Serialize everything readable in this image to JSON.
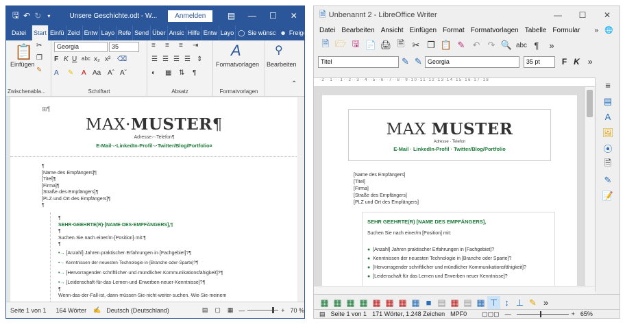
{
  "word": {
    "doc_title": "Unsere Geschichte.odt - W...",
    "signin": "Anmelden",
    "tabs": [
      "Datei",
      "Start",
      "Einfü",
      "Zeicl",
      "Entw",
      "Layo",
      "Refe",
      "Send",
      "Über",
      "Ansic",
      "Hilfe",
      "Entw",
      "Layo"
    ],
    "tell_me": "Sie wünsc",
    "share": "Freigeb",
    "paste": "Einfügen",
    "font_name": "Georgia",
    "font_size": "35",
    "styles": "Formatvorlagen",
    "edit": "Bearbeiten",
    "groups": [
      "Zwischenabla...",
      "Schriftart",
      "Absatz",
      "Formatvorlagen"
    ],
    "doc": {
      "name_light": "MAX·",
      "name_bold": "MUSTER",
      "contact": "Adresse·-·Telefon¶",
      "links": "E-Mail·-·LinkedIn-Profil·-·Twitter/Blog/Portfolio¤",
      "address": [
        "¶",
        "[Name·des·Empfängers]¶",
        "[Titel]¶",
        "[Firma]¶",
        "[Straße·des·Empfängers]¶",
        "[PLZ·und·Ort·des·Empfängers]¶",
        "¶"
      ],
      "greeting": "SEHR·GEEHRTE(R)·[NAME·DES·EMPFÄNGERS],¶",
      "intro": "Suchen·Sie·nach·einer/m·[Position]·mit:¶",
      "bullets": [
        "[Anzahl]·Jahren·praktischer·Erfahrungen·in·[Fachgebiet]?¶",
        "Kenntnissen·der·neuesten·Technologie·in·[Branche·oder·Sparte]?¶",
        "[Hervorragender·schriftlicher·und·mündlicher·Kommunikationsfähigkeit]?¶",
        "[Leidenschaft·für·das·Lernen·und·Erwerben·neuer·Kenntnisse]?¶"
      ],
      "tail": "Wenn·das·der·Fall·ist,·dann·müssen·Sie·nicht·weiter·suchen.·Wie·Sie·meinem"
    },
    "status": {
      "page": "Seite 1 von 1",
      "words": "164 Wörter",
      "lang": "Deutsch (Deutschland)",
      "zoom": "70 %"
    }
  },
  "lo": {
    "title": "Unbenannt 2 - LibreOffice Writer",
    "menu": [
      "Datei",
      "Bearbeiten",
      "Ansicht",
      "Einfügen",
      "Format",
      "Formatvorlagen",
      "Tabelle",
      "Formular"
    ],
    "para_style": "Titel",
    "font": "Georgia",
    "size": "35 pt",
    "doc": {
      "name_light": "MAX ",
      "name_bold": "MUSTER",
      "contact": "Adresse · Telefon",
      "links": "E-Mail · LinkedIn-Profil · Twitter/Blog/Portfolio",
      "address": [
        "[Name des Empfängers]",
        "[Titel]",
        "[Firma]",
        "[Straße des Empfängers]",
        "[PLZ und Ort des Empfängers]"
      ],
      "greeting": "SEHR GEEHRTE(R) [NAME DES EMPFÄNGERS],",
      "intro": "Suchen Sie nach einer/m [Position] mit:",
      "bullets": [
        "[Anzahl] Jahren praktischer Erfahrungen in [Fachgebiet]?",
        "Kenntnissen der neuesten Technologie in [Branche oder Sparte]?",
        "[Hervorragender schriftlicher und mündlicher Kommunikationsfähigkeit]?",
        "[Leidenschaft für das Lernen und Erwerben neuer Kenntnisse]?"
      ]
    },
    "status": {
      "page": "Seite 1 von 1",
      "words": "171 Wörter, 1.248 Zeichen",
      "lang": "MPF0",
      "zoom": "65%"
    }
  }
}
